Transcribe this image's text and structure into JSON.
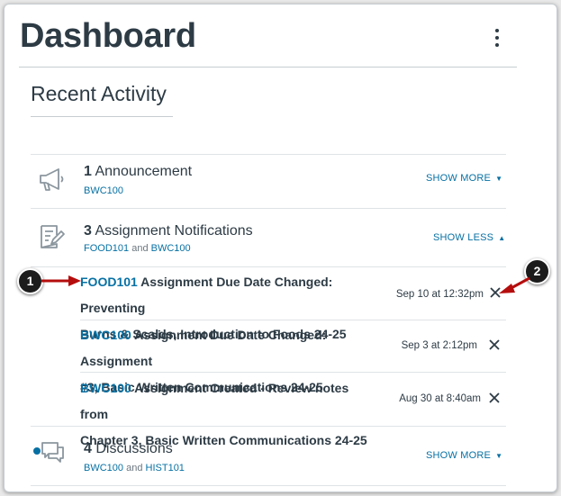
{
  "page": {
    "title": "Dashboard",
    "subtitle": "Recent Activity"
  },
  "colors": {
    "link": "#0770a3",
    "text": "#2d3b45",
    "callout_arrow": "#b50d0d",
    "unread_dot": "#0770a3"
  },
  "activity": [
    {
      "icon": "megaphone-icon",
      "count": "1",
      "label": "Announcement",
      "courses": [
        "BWC100"
      ],
      "toggle": "SHOW MORE",
      "caret": "▼"
    },
    {
      "icon": "assignment-icon",
      "count": "3",
      "label": "Assignment Notifications",
      "courses": [
        "FOOD101",
        "BWC100"
      ],
      "joiner": "and",
      "toggle": "SHOW LESS",
      "caret": "▲",
      "items": [
        {
          "course": "FOOD101",
          "line1": " Assignment Due Date Changed: Preventing",
          "line2": "Burns & Scalds, Introduction to Foods 24-25",
          "date": "Sep 10 at 12:32pm"
        },
        {
          "course": "BWC100",
          "line1": " Assignment Due Date Changed: Assignment",
          "line2": "#3, Basic Written Communications 24-25",
          "date": "Sep 3 at 2:12pm"
        },
        {
          "course": "BWC100",
          "line1": " Assignment Created - Review notes from",
          "line2": "Chapter 3, Basic Written Communications 24-25",
          "date": "Aug 30 at 8:40am"
        }
      ]
    },
    {
      "icon": "discussion-icon",
      "count": "4",
      "label": "Discussions",
      "courses": [
        "BWC100",
        "HIST101"
      ],
      "joiner": "and",
      "toggle": "SHOW MORE",
      "caret": "▼"
    }
  ],
  "callouts": [
    "1",
    "2"
  ]
}
